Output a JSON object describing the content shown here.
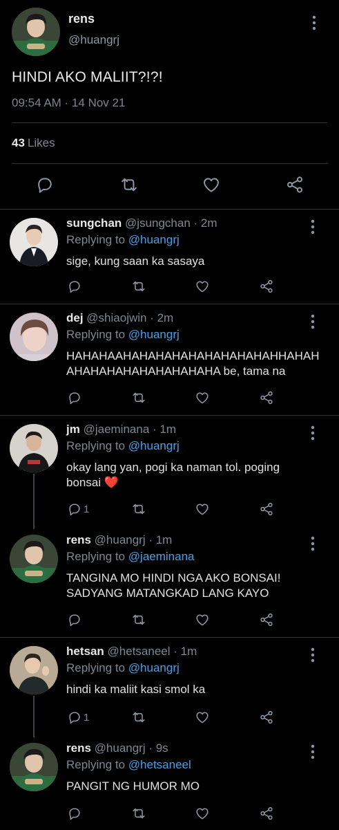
{
  "main_tweet": {
    "name": "rens",
    "handle": "@huangrj",
    "text": "HINDI AKO MALIIT?!?!",
    "timestamp": "09:54 AM · 14 Nov 21",
    "likes_count": "43",
    "likes_label": "Likes"
  },
  "replies": [
    {
      "name": "sungchan",
      "handle": "@jsungchan · 2m",
      "replying_label": "Replying to",
      "replying_to": "@huangrj",
      "text": "sige, kung saan ka sasaya",
      "reply_count": ""
    },
    {
      "name": "dej",
      "handle": "@shiaojwin · 2m",
      "replying_label": "Replying to",
      "replying_to": "@huangrj",
      "text": "HAHAHAAHAHAHAHAHAHAHAHAHAHHAHAH AHAHAHAHAHAHAHAHAHA be, tama na",
      "reply_count": ""
    },
    {
      "name": "jm",
      "handle": "@jaeminana · 1m",
      "replying_label": "Replying to",
      "replying_to": "@huangrj",
      "text": "okay lang yan, pogi ka naman tol. poging bonsai ❤️",
      "reply_count": "1"
    },
    {
      "name": "rens",
      "handle": "@huangrj · 1m",
      "replying_label": "Replying to",
      "replying_to": "@jaeminana",
      "text": "TANGINA MO HINDI NGA AKO BONSAI! SADYANG MATANGKAD LANG KAYO",
      "reply_count": ""
    },
    {
      "name": "hetsan",
      "handle": "@hetsaneel · 1m",
      "replying_label": "Replying to",
      "replying_to": "@huangrj",
      "text": "hindi ka maliit kasi smol ka",
      "reply_count": "1"
    },
    {
      "name": "rens",
      "handle": "@huangrj · 9s",
      "replying_label": "Replying to",
      "replying_to": "@hetsaneel",
      "text": "PANGIT NG HUMOR MO",
      "reply_count": ""
    }
  ],
  "colors": {
    "background": "#000000",
    "link": "#4a9fe3",
    "muted": "#7c8891",
    "heart": "#e0245e"
  },
  "icons": [
    "reply-icon",
    "retweet-icon",
    "like-icon",
    "share-icon",
    "more-icon"
  ]
}
